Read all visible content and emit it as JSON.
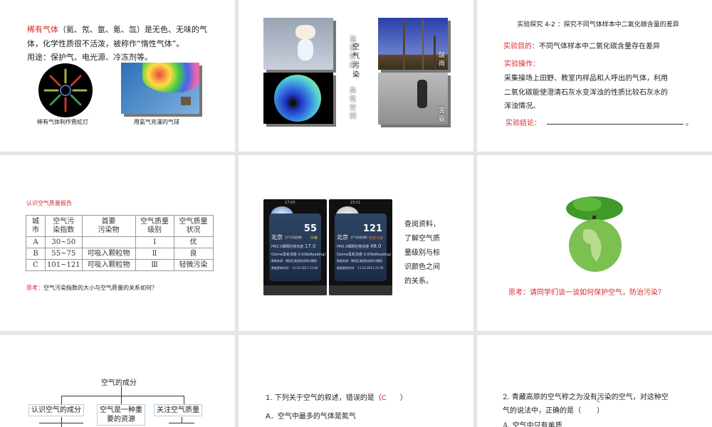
{
  "slides": [
    {
      "highlight": "稀有气体",
      "line1_rest": "（氦、氖、氩、氪、氙）是无色、无味的气",
      "line2": "体，化学性质很不活泼，被称作“惰性气体”。",
      "line3": "用途：保护气、电光源、冷冻剂等。",
      "caption_left": "稀有气体制作霓虹灯",
      "caption_right": "用氦气充灌的气球"
    },
    {
      "center_label": "空气污染",
      "labels": [
        "温室效应",
        "臭氧空洞",
        "酸雨",
        "雾霾"
      ]
    },
    {
      "title": "实验探究 4-2 ：探究不同气体样本中二氧化碳含量的差异",
      "purpose_label": "实验目的：",
      "purpose": "不同气体样本中二氧化碳含量存在差异",
      "operation_label": "实验操作：",
      "operation_lines": [
        "采集操场上田野、教室内样品和人呼出的气体，利用",
        "二氧化碳能使澄清石灰水变浑浊的性质比较石灰水的",
        "浑浊情况。"
      ],
      "conclusion_label": "实验结论：",
      "conclusion_end": "。"
    },
    {
      "title": "认识空气质量报告",
      "table": {
        "headers": [
          [
            "城",
            "市"
          ],
          [
            "空气污",
            "染指数"
          ],
          [
            "首要",
            "污染物"
          ],
          [
            "空气质量",
            "级别"
          ],
          [
            "空气质量",
            "状况"
          ]
        ],
        "rows": [
          [
            "A",
            "30~50",
            "",
            "Ⅰ",
            "优"
          ],
          [
            "B",
            "55~75",
            "可吸入颗粒物",
            "Ⅱ",
            "良"
          ],
          [
            "C",
            "101~121",
            "可吸入颗粒物",
            "Ⅲ",
            "轻微污染"
          ]
        ]
      },
      "think_label": "思考：",
      "think": "空气污染指数的大小与空气质量的关系如何？"
    },
    {
      "phones": [
        {
          "time": "17:03",
          "index": "55",
          "city": "北京",
          "sub": "空气质量指数",
          "level": "中等",
          "pm_label": "PM2.5细颗粒物浓度",
          "pm": "17.0",
          "ozone": "Ozone臭氧浓度  0.0(NoReading)",
          "source": "数据来源：朝阳区美国驻使馆对播报",
          "updated": "数据更新时间：  11-22-2011 15:00"
        },
        {
          "time": "23:11",
          "index": "121",
          "city": "北京",
          "sub": "空气质量指数",
          "level": "轻度污染",
          "pm_label": "PM2.5细颗粒物浓度",
          "pm": "48.0",
          "ozone": "Ozone臭氧浓度  0.0(NoReading)",
          "source": "数据来源：朝阳区美国驻使馆对播报",
          "updated": "数据更新时间：  11-23-2011 21:00"
        }
      ],
      "text_lines": [
        "查阅资料，",
        "了解空气质",
        "量级别与标",
        "识颜色之间",
        "的关系。"
      ]
    },
    {
      "think": "思考：请同学们谈一谈如何保护空气，防治污染？"
    },
    {
      "root": "空气的成分",
      "branches": [
        "认识空气的成分",
        "空气是一种重要的资源",
        "关注空气质量"
      ]
    },
    {
      "question": "1. 下列关于空气的叙述，错误的是（",
      "answer": "C",
      "close": "）",
      "option_a": "A．空气中最多的气体是氮气"
    },
    {
      "question_line1": "2. 青藏高原的空气称之为没有污染的空气，对这种空",
      "question_line2": "气的说法中，正确的是（",
      "close": "）",
      "answer": "C",
      "option_a": "A. 空气中只有单质"
    }
  ]
}
